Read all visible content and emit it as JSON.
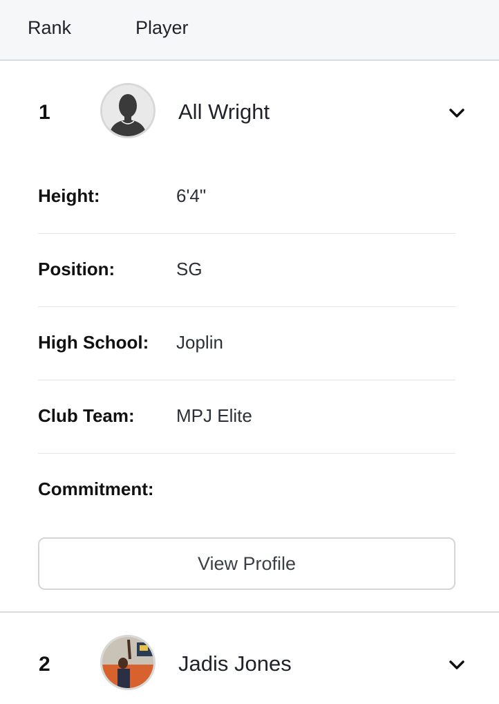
{
  "header": {
    "rank_label": "Rank",
    "player_label": "Player"
  },
  "players": [
    {
      "rank": "1",
      "name": "All Wright",
      "avatar": "default-silhouette",
      "expanded": true,
      "details": [
        {
          "label": "Height:",
          "value": "6'4\""
        },
        {
          "label": "Position:",
          "value": "SG"
        },
        {
          "label": "High School:",
          "value": "Joplin"
        },
        {
          "label": "Club Team:",
          "value": "MPJ Elite"
        },
        {
          "label": "Commitment:",
          "value": ""
        }
      ],
      "view_profile_label": "View Profile"
    },
    {
      "rank": "2",
      "name": "Jadis Jones",
      "avatar": "photo",
      "expanded": false
    }
  ],
  "icons": {
    "expand": "chevron-down-icon"
  },
  "colors": {
    "header_bg": "#f6f7f9",
    "divider": "#d9dbde",
    "text": "#1f2329"
  }
}
